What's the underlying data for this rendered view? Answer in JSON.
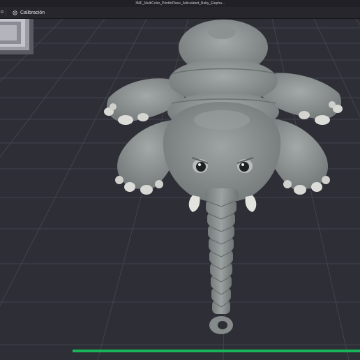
{
  "window": {
    "title": "3MF_MultiColor_PrintInPlace_Articulated_Baby_Elepha..."
  },
  "tabs": {
    "previous_tab_label": "o",
    "calibration_label": "Calibración",
    "calibration_icon": "calibration-target-icon"
  },
  "viewport": {
    "model": "articulated baby elephant model",
    "background_color": "#2e2e36",
    "grid_color": "#43434d",
    "model_color": "#8b9090",
    "claw_color": "#d8d8d4"
  },
  "progress": {
    "fraction": 1.0,
    "color": "#18b458"
  }
}
